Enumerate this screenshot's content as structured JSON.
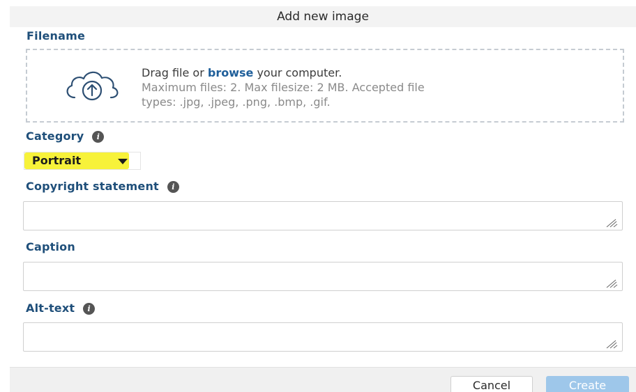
{
  "dialog": {
    "title": "Add new image"
  },
  "filename": {
    "label": "Filename",
    "dropzone": {
      "icon": "cloud-upload-icon",
      "prefix": "Drag file or ",
      "browse_link": "browse",
      "suffix": " your computer.",
      "hint_line1": "Maximum files: 2. Max filesize: 2 MB. Accepted file",
      "hint_line2": "types: .jpg, .jpeg, .png, .bmp, .gif."
    }
  },
  "category": {
    "label": "Category",
    "info_icon": "i",
    "selected": "Portrait",
    "highlight_color": "#f7f23a"
  },
  "copyright": {
    "label": "Copyright statement",
    "info_icon": "i",
    "value": ""
  },
  "caption": {
    "label": "Caption",
    "value": ""
  },
  "alt_text": {
    "label": "Alt-text",
    "info_icon": "i",
    "value": ""
  },
  "footer": {
    "cancel_label": "Cancel",
    "create_label": "Create",
    "create_color": "#9ec7ea"
  }
}
